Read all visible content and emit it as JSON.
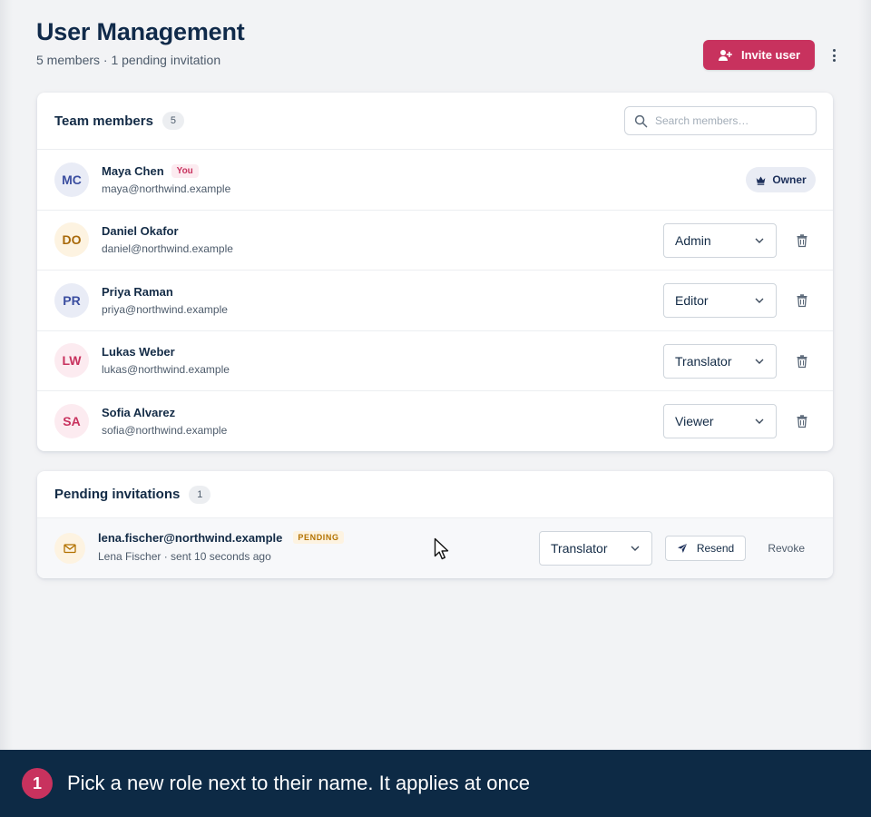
{
  "header": {
    "title": "User Management",
    "subtitle": "5 members · 1 pending invitation",
    "invite_label": "Invite user"
  },
  "team": {
    "title": "Team members",
    "count": "5",
    "search_placeholder": "Search members…",
    "members": [
      {
        "initials": "MC",
        "name": "Maya Chen",
        "email": "maya@northwind.example",
        "you": "You",
        "owner": "Owner",
        "avatar_bg": "#e9ecf6",
        "avatar_fg": "#3b4ea0"
      },
      {
        "initials": "DO",
        "name": "Daniel Okafor",
        "email": "daniel@northwind.example",
        "role": "Admin",
        "avatar_bg": "#fdf3e1",
        "avatar_fg": "#a8690a"
      },
      {
        "initials": "PR",
        "name": "Priya Raman",
        "email": "priya@northwind.example",
        "role": "Editor",
        "avatar_bg": "#e9ecf6",
        "avatar_fg": "#3b4ea0"
      },
      {
        "initials": "LW",
        "name": "Lukas Weber",
        "email": "lukas@northwind.example",
        "role": "Translator",
        "avatar_bg": "#fcebf0",
        "avatar_fg": "#c8325e"
      },
      {
        "initials": "SA",
        "name": "Sofia Alvarez",
        "email": "sofia@northwind.example",
        "role": "Viewer",
        "avatar_bg": "#fcebf0",
        "avatar_fg": "#c8325e"
      }
    ]
  },
  "pending": {
    "title": "Pending invitations",
    "count": "1",
    "invites": [
      {
        "email": "lena.fischer@northwind.example",
        "badge": "PENDING",
        "sub": "Lena Fischer · sent 10 seconds ago",
        "role": "Translator",
        "resend": "Resend",
        "revoke": "Revoke"
      }
    ]
  },
  "footer": {
    "step": "1",
    "text": "Pick a new role next to their name. It applies at once"
  },
  "colors": {
    "accent": "#c8325e",
    "navy": "#0d2a45",
    "text": "#132b46"
  },
  "icons": {
    "invite": "user-plus-icon",
    "search": "search-icon",
    "owner": "crown-icon",
    "select": "chevron-down-icon",
    "delete": "trash-icon",
    "mail": "mail-icon",
    "resend": "send-icon",
    "more": "more-vertical-icon",
    "cursor": "mouse-cursor-icon"
  }
}
